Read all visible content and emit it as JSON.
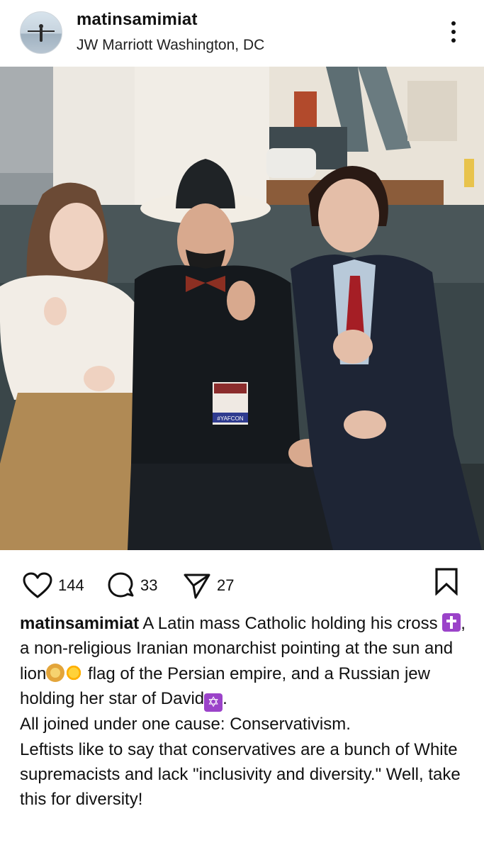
{
  "post": {
    "username": "matinsamimiat",
    "location": "JW Marriott Washington, DC",
    "badge_text": "#YAFCON",
    "likes": "144",
    "comments": "33",
    "shares": "27",
    "caption_username": "matinsamimiat",
    "caption_parts": {
      "p1": " A Latin mass Catholic holding his cross ",
      "p2": ", a non-religious Iranian monarchist pointing at the sun and lion",
      "p3": " flag of the Persian empire, and a Russian jew holding her star of David",
      "p4": ".",
      "line2": "All joined under one cause: Conservativism.",
      "line3": "Leftists like to say that conservatives are a bunch of White supremacists and lack \"inclusivity and diversity.\" Well, take this for diversity!"
    }
  },
  "icons": {
    "more": "more-options-icon",
    "like": "heart-icon",
    "comment": "comment-bubble-icon",
    "share": "send-icon",
    "save": "bookmark-icon",
    "cross_emoji": "latin-cross-emoji",
    "lion_emoji": "lion-face-emoji",
    "sun_emoji": "sun-emoji",
    "star_emoji": "star-of-david-emoji"
  },
  "colors": {
    "text": "#111111",
    "background": "#ffffff",
    "emoji_purple": "#9b43c9"
  }
}
